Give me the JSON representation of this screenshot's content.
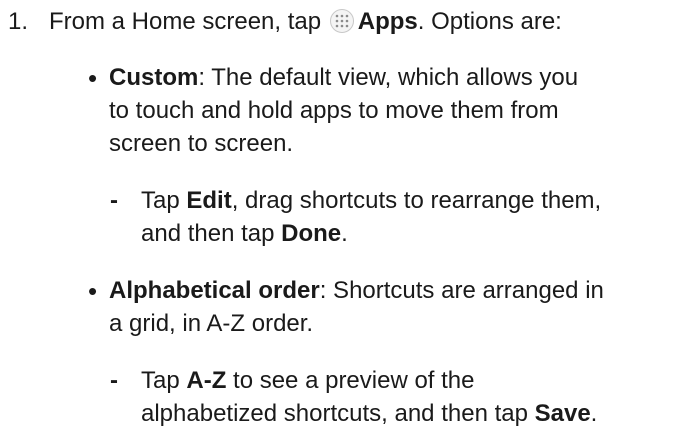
{
  "step": {
    "number": "1.",
    "text_before": "From a Home screen, tap",
    "icon": "apps-grid-icon",
    "apps_label": "Apps",
    "text_after": ". Options are:"
  },
  "options": [
    {
      "bullet": "•",
      "title": "Custom",
      "desc_lines": [
        ": The default view, which allows you",
        "to touch and hold apps to move them from",
        "screen to screen."
      ],
      "sub": {
        "dash": "-",
        "p1": "Tap ",
        "b1": "Edit",
        "p2": ", drag shortcuts to rearrange them,",
        "p3": "and then tap ",
        "b2": "Done",
        "p4": "."
      }
    },
    {
      "bullet": "•",
      "title": "Alphabetical order",
      "desc_lines": [
        ": Shortcuts are arranged in",
        "a grid, in A-Z order."
      ],
      "sub": {
        "dash": "-",
        "p1": "Tap ",
        "b1": "A-Z",
        "p2": " to see a preview of the",
        "p3": "alphabetized shortcuts, and then tap ",
        "b2": "Save",
        "p4": "."
      }
    }
  ]
}
